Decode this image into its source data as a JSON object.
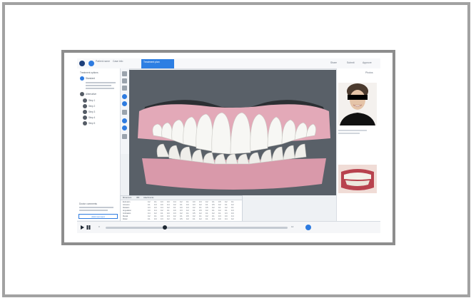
{
  "topbar": {
    "patient_name": "Patient name",
    "case_info": "Case info",
    "active_tab": "Treatment plan",
    "right_label_1": "Share",
    "right_label_2": "Submit",
    "right_label_3": "Approve"
  },
  "left_panel": {
    "section_title": "Treatment options",
    "option_1": "Standard",
    "option_2": "Alternative",
    "steps": [
      "Step 1",
      "Step 2",
      "Step 3",
      "Step 4",
      "Step 5"
    ],
    "footer_note": "Doctor comments",
    "footer_button": "Add comment"
  },
  "right_panel": {
    "header": "Photos"
  },
  "table": {
    "tabs": [
      "Movement",
      "IPR",
      "Attachments"
    ],
    "rows": [
      "Extrusion",
      "Intrusion",
      "Rotation",
      "Angulation",
      "Inclination",
      "Mesial",
      "Distal"
    ],
    "cells": [
      "0.2",
      "0.1",
      "0.3",
      "0.0",
      "0.4",
      "0.2",
      "0.1",
      "0.0",
      "0.3",
      "0.2",
      "0.1",
      "0.5",
      "0.2",
      "0.1"
    ]
  },
  "timeline": {
    "start_label": "0",
    "end_label": "14"
  },
  "colors": {
    "accent": "#2e7be0",
    "viewport": "#596068",
    "gum": "#e3a9b8",
    "tooth": "#f7f7f4"
  },
  "icons": {
    "logo": "app-logo-icon",
    "play": "play-icon",
    "pause": "pause-icon",
    "rotate": "rotate-icon",
    "zoom": "zoom-icon"
  }
}
